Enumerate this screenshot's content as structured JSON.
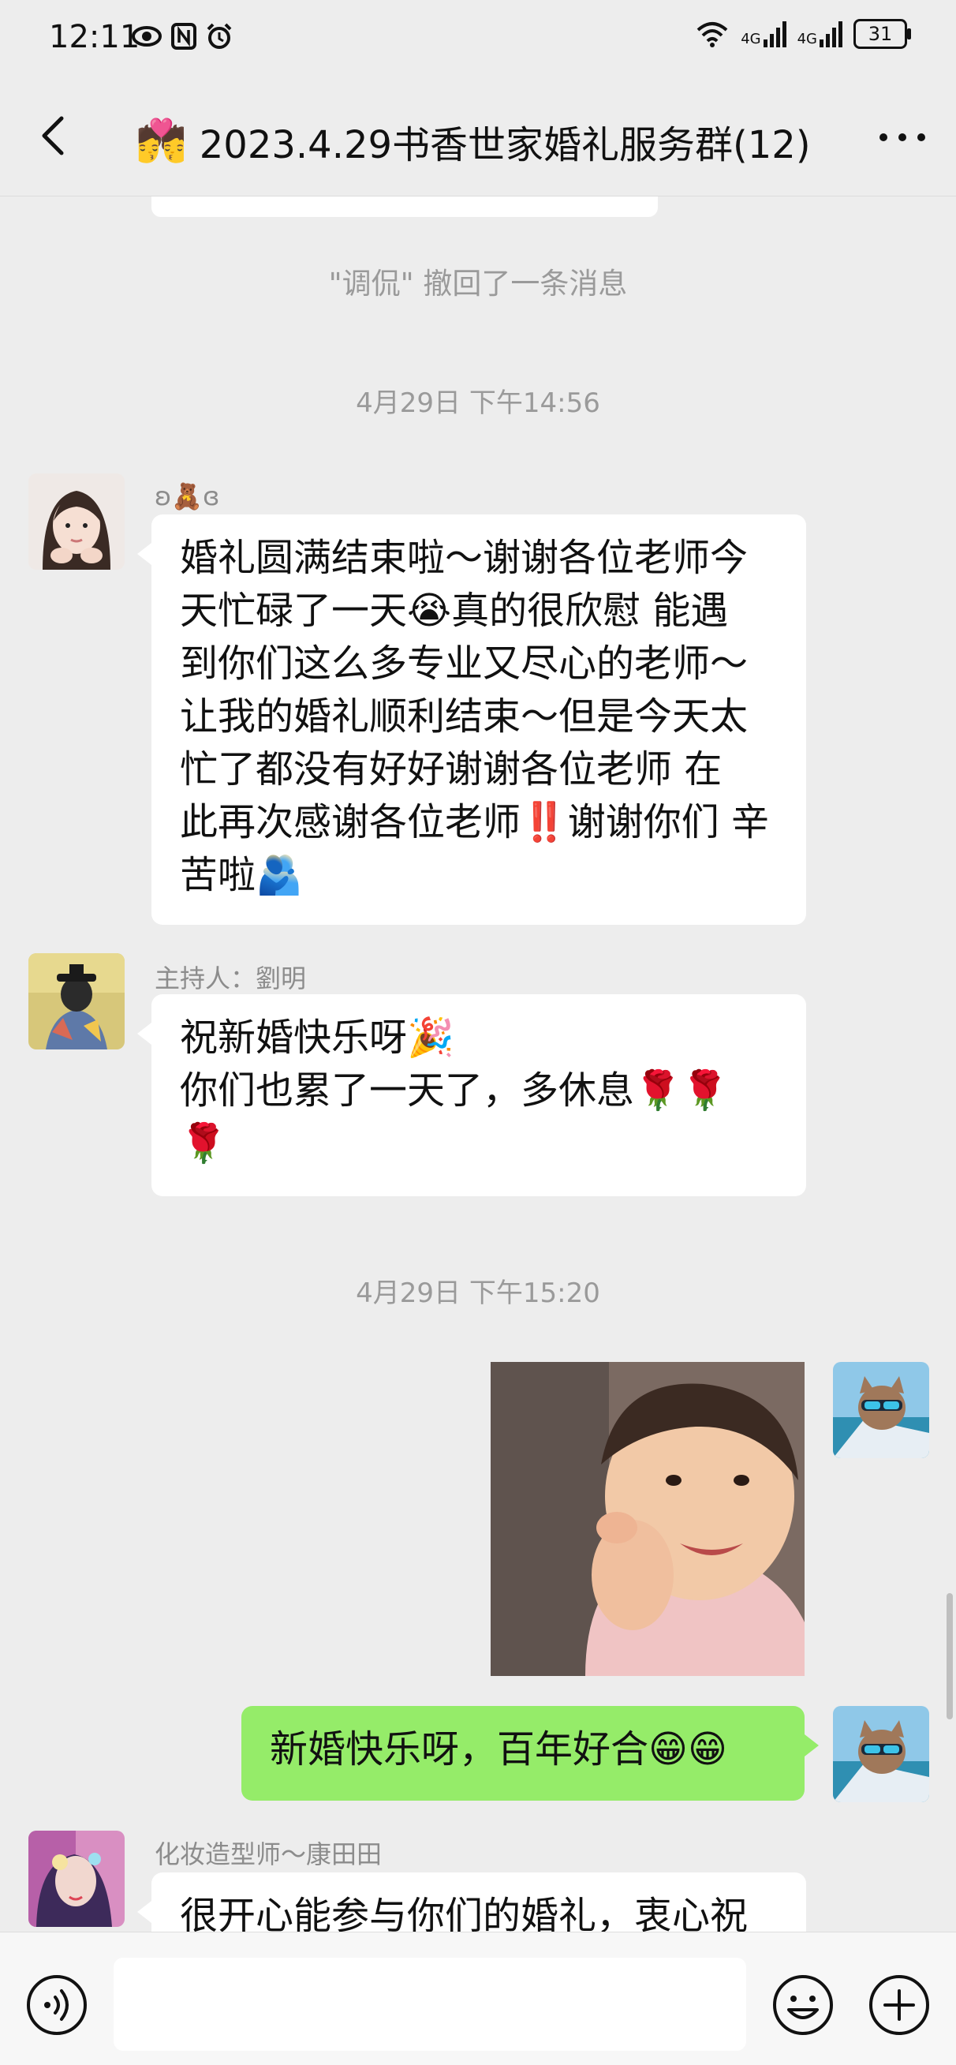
{
  "status_bar": {
    "time": "12:11",
    "network_1": "4G",
    "network_2": "4G",
    "battery": "31"
  },
  "header": {
    "title_emoji": "💏",
    "title": "2023.4.29书香世家婚礼服务群(12)"
  },
  "chat": {
    "system_note": "\"调侃\" 撤回了一条消息",
    "timestamps": [
      "4月29日 下午14:56",
      "4月29日 下午15:20"
    ],
    "messages": [
      {
        "sender": "ʚ🧸ɞ",
        "lines": [
          "婚礼圆满结束啦～谢谢各位老师今",
          "天忙碌了一天😭真的很欣慰 能遇",
          "到你们这么多专业又尽心的老师～",
          "让我的婚礼顺利结束～但是今天太",
          "忙了都没有好好谢谢各位老师 在",
          "此再次感谢各位老师‼️谢谢你们 辛",
          "苦啦🫂"
        ]
      },
      {
        "sender": "主持人：劉明",
        "lines": [
          "祝新婚快乐呀🎉",
          "你们也累了一天了，多休息🌹🌹",
          "🌹"
        ]
      },
      {
        "sender": "",
        "lines": [
          "新婚快乐呀，百年好合😁😁"
        ]
      },
      {
        "sender": "化妆造型师～康田田",
        "lines": [
          "很开心能参与你们的婚礼，衷心祝"
        ]
      }
    ]
  },
  "input": {
    "placeholder": ""
  },
  "icons": {
    "back": "chevron-left-icon",
    "more": "more-dots-icon",
    "voice": "voice-icon",
    "emoji": "emoji-icon",
    "plus": "plus-icon"
  },
  "colors": {
    "background": "#ededed",
    "outgoing_bubble": "#95ec69",
    "incoming_bubble": "#ffffff"
  }
}
